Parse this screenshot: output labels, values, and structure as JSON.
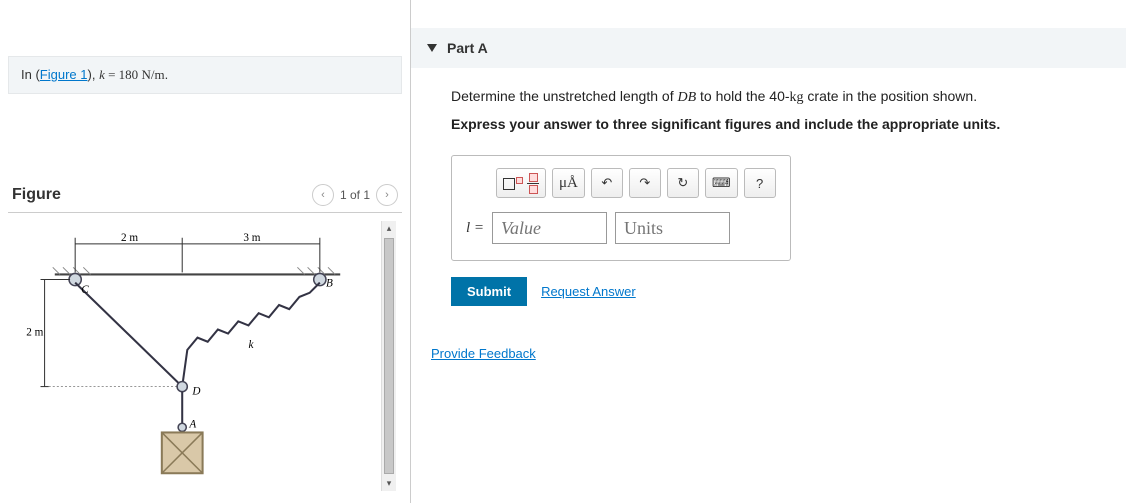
{
  "problem": {
    "prefix": "In (",
    "link": "Figure 1",
    "suffix": "), ",
    "var": "k",
    "eq": " = 180 ",
    "unit": "N/m",
    "dot": "."
  },
  "figure": {
    "title": "Figure",
    "counter": "1 of 1",
    "labels": {
      "d1": "2 m",
      "d2": "3 m",
      "d3": "2 m",
      "k": "k",
      "A": "A",
      "B": "B",
      "C": "C",
      "D": "D"
    }
  },
  "part": {
    "title": "Part A",
    "question_pre": "Determine the unstretched length of ",
    "question_var": "DB",
    "question_post": " to hold the 40-",
    "question_unit": "kg",
    "question_end": " crate in the position shown.",
    "instruction": "Express your answer to three significant figures and include the appropriate units."
  },
  "toolbar": {
    "greek": "μÅ",
    "help": "?"
  },
  "answer": {
    "lhs": "l = ",
    "value_placeholder": "Value",
    "units_placeholder": "Units"
  },
  "actions": {
    "submit": "Submit",
    "request": "Request Answer",
    "feedback": "Provide Feedback"
  }
}
